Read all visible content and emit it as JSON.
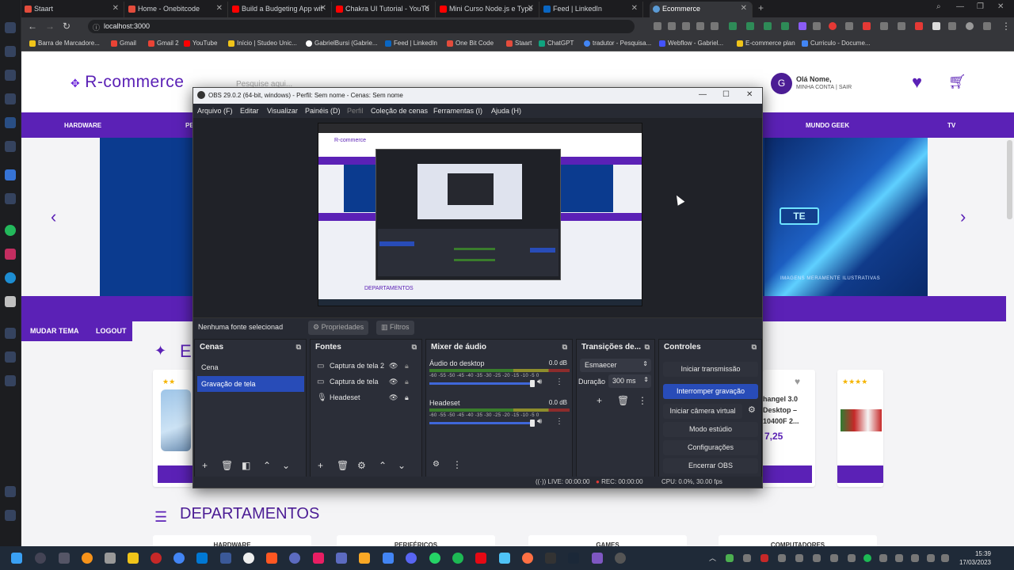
{
  "browser": {
    "tabs": [
      {
        "label": "Staart",
        "color": "#e34c3c"
      },
      {
        "label": "Home - Onebitcode",
        "color": "#e34c3c"
      },
      {
        "label": "Build a Budgeting App wit",
        "color": "#ff0000"
      },
      {
        "label": "Chakra UI Tutorial - YouTu",
        "color": "#ff0000"
      },
      {
        "label": "Mini Curso Node.js e Type",
        "color": "#ff0000"
      },
      {
        "label": "Feed | LinkedIn",
        "color": "#0a66c2"
      },
      {
        "label": "Ecommerce",
        "color": "#5b9bd5"
      }
    ],
    "active_tab_index": 6,
    "url": "localhost:3000",
    "bookmarks": [
      {
        "label": "Barra de Marcadore...",
        "color": "#f0c419"
      },
      {
        "label": "Gmail",
        "color": "#ea4335"
      },
      {
        "label": "Gmail 2",
        "color": "#ea4335"
      },
      {
        "label": "YouTube",
        "color": "#ff0000"
      },
      {
        "label": "Início | Studeo Unic...",
        "color": "#f0c419"
      },
      {
        "label": "GabrielBursi (Gabrie...",
        "color": "#ffffff"
      },
      {
        "label": "Feed | LinkedIn",
        "color": "#0a66c2"
      },
      {
        "label": "One Bit Code",
        "color": "#e34c3c"
      },
      {
        "label": "Staart",
        "color": "#e34c3c"
      },
      {
        "label": "ChatGPT",
        "color": "#10a37f"
      },
      {
        "label": "tradutor - Pesquisa...",
        "color": "#4285f4"
      },
      {
        "label": "Webflow - Gabriel...",
        "color": "#4353ff"
      },
      {
        "label": "E-commerce plan",
        "color": "#f0c419"
      },
      {
        "label": "Curriculo - Docume...",
        "color": "#4285f4"
      }
    ]
  },
  "site": {
    "logo": "R-commerce",
    "search_placeholder": "Pesquise aqui...",
    "avatar_letter": "G",
    "greeting": "Olá Nome,",
    "account_link": "MINHA CONTA",
    "logout_link": "SAIR",
    "categories": [
      "HARDWARE",
      "PE",
      "MUNDO GEEK",
      "TV"
    ],
    "banner_cta": "TE",
    "banner_note": "IMAGENS MERAMENTE ILUSTRATIVAS",
    "theme_button": "MUDAR TEMA",
    "logout_button": "LOGOUT",
    "section_letter": "E",
    "product": {
      "name": "hangel 3.0 Desktop – 10400F 2...",
      "price": "7,25"
    },
    "departments_title": "DEPARTAMENTOS",
    "departments": [
      "HARDWARE",
      "PERIFÉRICOS",
      "GAMES",
      "COMPUTADORES"
    ],
    "accent": "#5b21b6"
  },
  "obs": {
    "title": "OBS 29.0.2 (64-bit, windows) - Perfil: Sem nome - Cenas: Sem nome",
    "menu": [
      "Arquivo (F)",
      "Editar",
      "Visualizar",
      "Painéis (D)",
      "Perfil",
      "Coleção de cenas",
      "Ferramentas (I)",
      "Ajuda (H)"
    ],
    "no_source": "Nenhuma fonte selecionad",
    "properties_btn": "Propriedades",
    "filters_btn": "Filtros",
    "preview_dept": "DEPARTAMENTOS",
    "scenes_title": "Cenas",
    "scenes": [
      "Cena",
      "Gravação de tela"
    ],
    "sources_title": "Fontes",
    "sources": [
      "Captura de tela 2",
      "Captura de tela",
      "Headeset"
    ],
    "mixer_title": "Mixer de áudio",
    "channels": [
      {
        "name": "Áudio do desktop",
        "db": "0.0 dB"
      },
      {
        "name": "Headeset",
        "db": "0.0 dB"
      }
    ],
    "meter_scale": "-60 -55 -50 -45 -40 -35 -30 -25 -20 -15 -10 -5 0",
    "transitions_title": "Transições de...",
    "transition": "Esmaecer",
    "duration_label": "Duração",
    "duration_value": "300 ms",
    "controls_title": "Controles",
    "controls": [
      "Iniciar transmissão",
      "Interromper gravação",
      "Iniciar câmera virtual",
      "Modo estúdio",
      "Configurações",
      "Encerrar OBS"
    ],
    "status": {
      "live": "LIVE: 00:00:00",
      "rec": "REC: 00:00:00",
      "cpu": "CPU: 0.0%, 30.00 fps"
    }
  },
  "taskbar": {
    "time": "15:39",
    "date": "17/03/2023"
  }
}
